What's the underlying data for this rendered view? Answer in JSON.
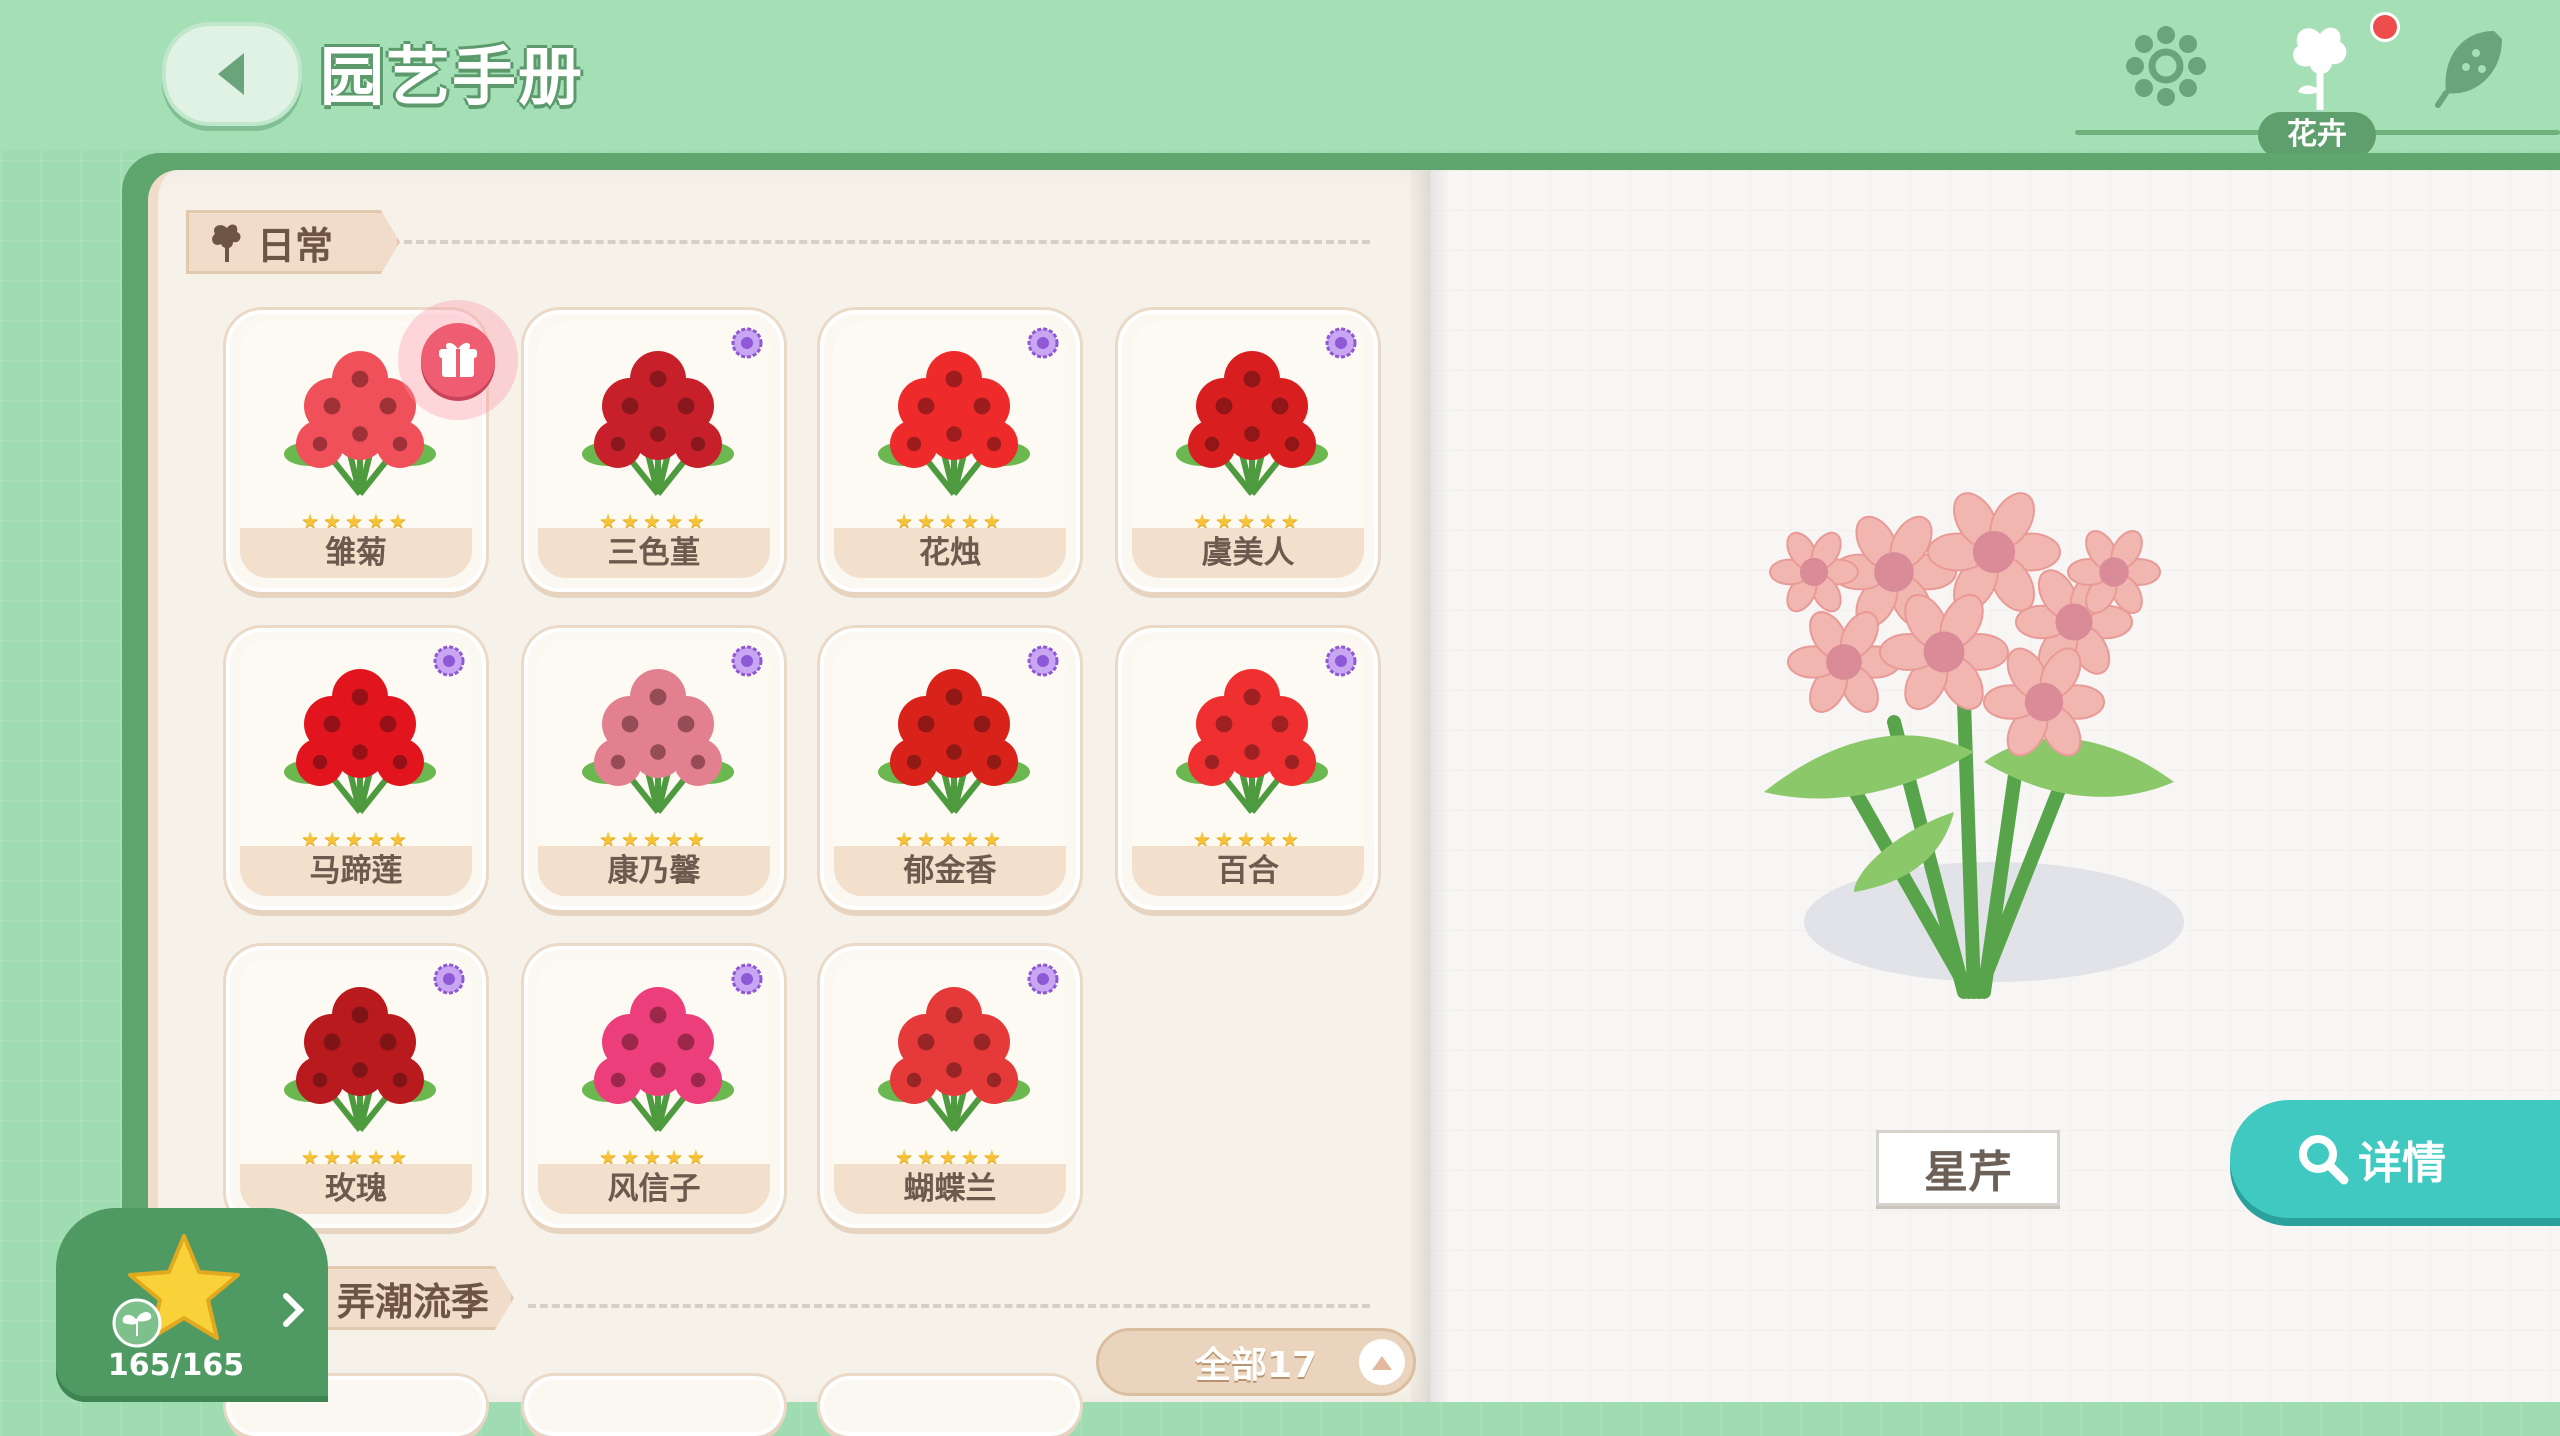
{
  "header": {
    "title": "园艺手册",
    "active_tab": "花卉"
  },
  "section_daily": {
    "label": "日常"
  },
  "section_trend": {
    "label": "弄潮流季"
  },
  "flowers": [
    {
      "name": "雏菊",
      "stars": "★★★★★",
      "color": "#f0505a"
    },
    {
      "name": "三色堇",
      "stars": "★★★★★",
      "color": "#c8202a"
    },
    {
      "name": "花烛",
      "stars": "★★★★★",
      "color": "#ee2a2a"
    },
    {
      "name": "虞美人",
      "stars": "★★★★★",
      "color": "#d81e1e"
    },
    {
      "name": "马蹄莲",
      "stars": "★★★★★",
      "color": "#e2151e"
    },
    {
      "name": "康乃馨",
      "stars": "★★★★★",
      "color": "#e28090"
    },
    {
      "name": "郁金香",
      "stars": "★★★★★",
      "color": "#d8221a"
    },
    {
      "name": "百合",
      "stars": "★★★★★",
      "color": "#f03030"
    },
    {
      "name": "玫瑰",
      "stars": "★★★★★",
      "color": "#b81a1e"
    },
    {
      "name": "风信子",
      "stars": "★★★★★",
      "color": "#ec3e7a"
    },
    {
      "name": "蝴蝶兰",
      "stars": "★★★★★",
      "color": "#e63a3a"
    }
  ],
  "progress": {
    "count": "165/165"
  },
  "filter": {
    "label": "全部17"
  },
  "selected_flower": {
    "name": "星芹",
    "color": "#f1b6b0"
  },
  "detail_button": {
    "label": "详情"
  }
}
